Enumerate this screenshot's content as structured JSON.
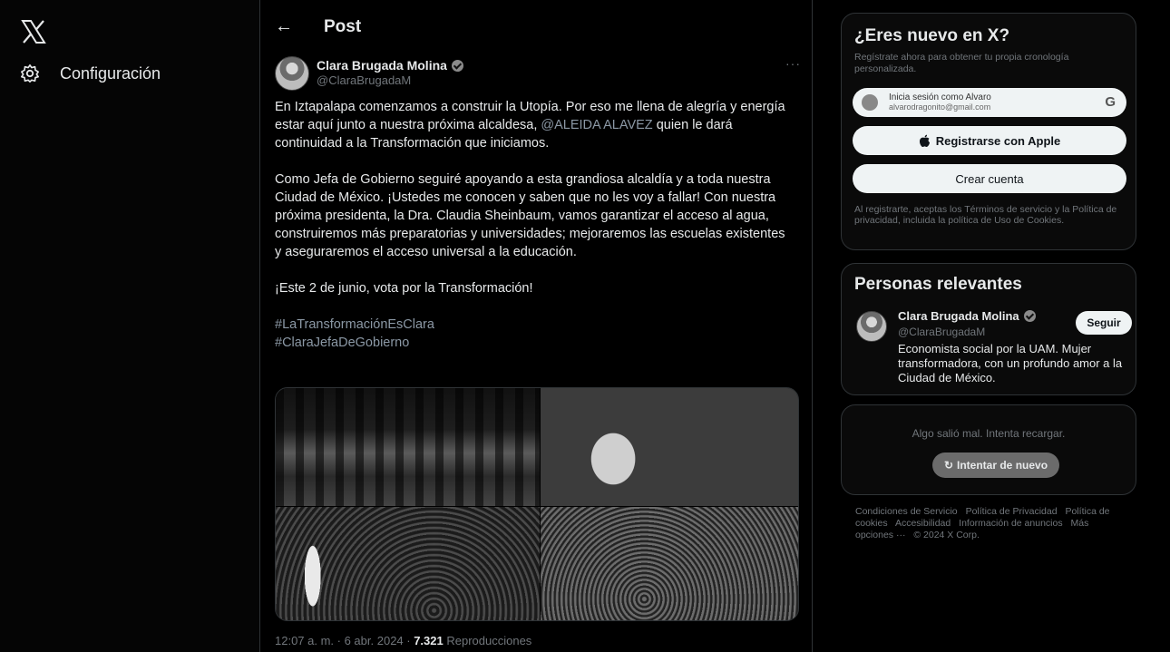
{
  "nav": {
    "settings_label": "Configuración"
  },
  "header": {
    "back_symbol": "←",
    "title": "Post"
  },
  "post": {
    "author_name": "Clara Brugada Molina",
    "author_handle": "@ClaraBrugadaM",
    "more_symbol": "···",
    "paragraph1_before": "En Iztapalapa comenzamos a construir la Utopía. Por eso me llena de alegría y energía estar aquí junto a nuestra próxima alcaldesa, ",
    "paragraph1_mention": "@ALEIDA ALAVEZ",
    "paragraph1_after": " quien le dará continuidad a la Transformación que iniciamos.",
    "paragraph2": "Como Jefa de Gobierno seguiré apoyando a esta grandiosa alcaldía y a toda nuestra Ciudad de México. ¡Ustedes me conocen y saben que no les voy a fallar! Con nuestra próxima presidenta, la Dra. Claudia Sheinbaum, vamos garantizar el acceso al agua, construiremos más preparatorias y universidades; mejoraremos las escuelas existentes y aseguraremos el acceso universal a la educación.",
    "paragraph3": "¡Este 2 de junio, vota por la Transformación!",
    "hashtag1": "#LaTransformaciónEsClara",
    "hashtag2": "#ClaraJefaDeGobierno",
    "time": "12:07 a. m. · 6 abr. 2024 · ",
    "views": "7.321",
    "views_label": " Reproducciones"
  },
  "signup": {
    "title": "¿Eres nuevo en X?",
    "subtitle": "Regístrate ahora para obtener tu propia cronología personalizada.",
    "google_name": "Inicia sesión como Alvaro",
    "google_email": "alvarodragonito@gmail.com",
    "google_icon": "G",
    "apple_icon": "",
    "apple_label": "Registrarse con Apple",
    "create_label": "Crear cuenta",
    "legal": "Al registrarte, aceptas los Términos de servicio y la Política de privacidad, incluida la política de Uso de Cookies."
  },
  "relevant": {
    "title": "Personas relevantes",
    "name": "Clara Brugada Molina",
    "handle": "@ClaraBrugadaM",
    "bio": "Economista social por la UAM. Mujer transformadora, con un profundo amor a la Ciudad de México.",
    "follow_label": "Seguir"
  },
  "error": {
    "message": "Algo salió mal. Intenta recargar.",
    "retry_icon": "↻",
    "retry_label": "Intentar de nuevo"
  },
  "footer": {
    "links": [
      "Condiciones de Servicio",
      "Política de Privacidad",
      "Política de cookies",
      "Accesibilidad",
      "Información de anuncios",
      "Más opciones ···",
      "© 2024 X Corp."
    ]
  }
}
